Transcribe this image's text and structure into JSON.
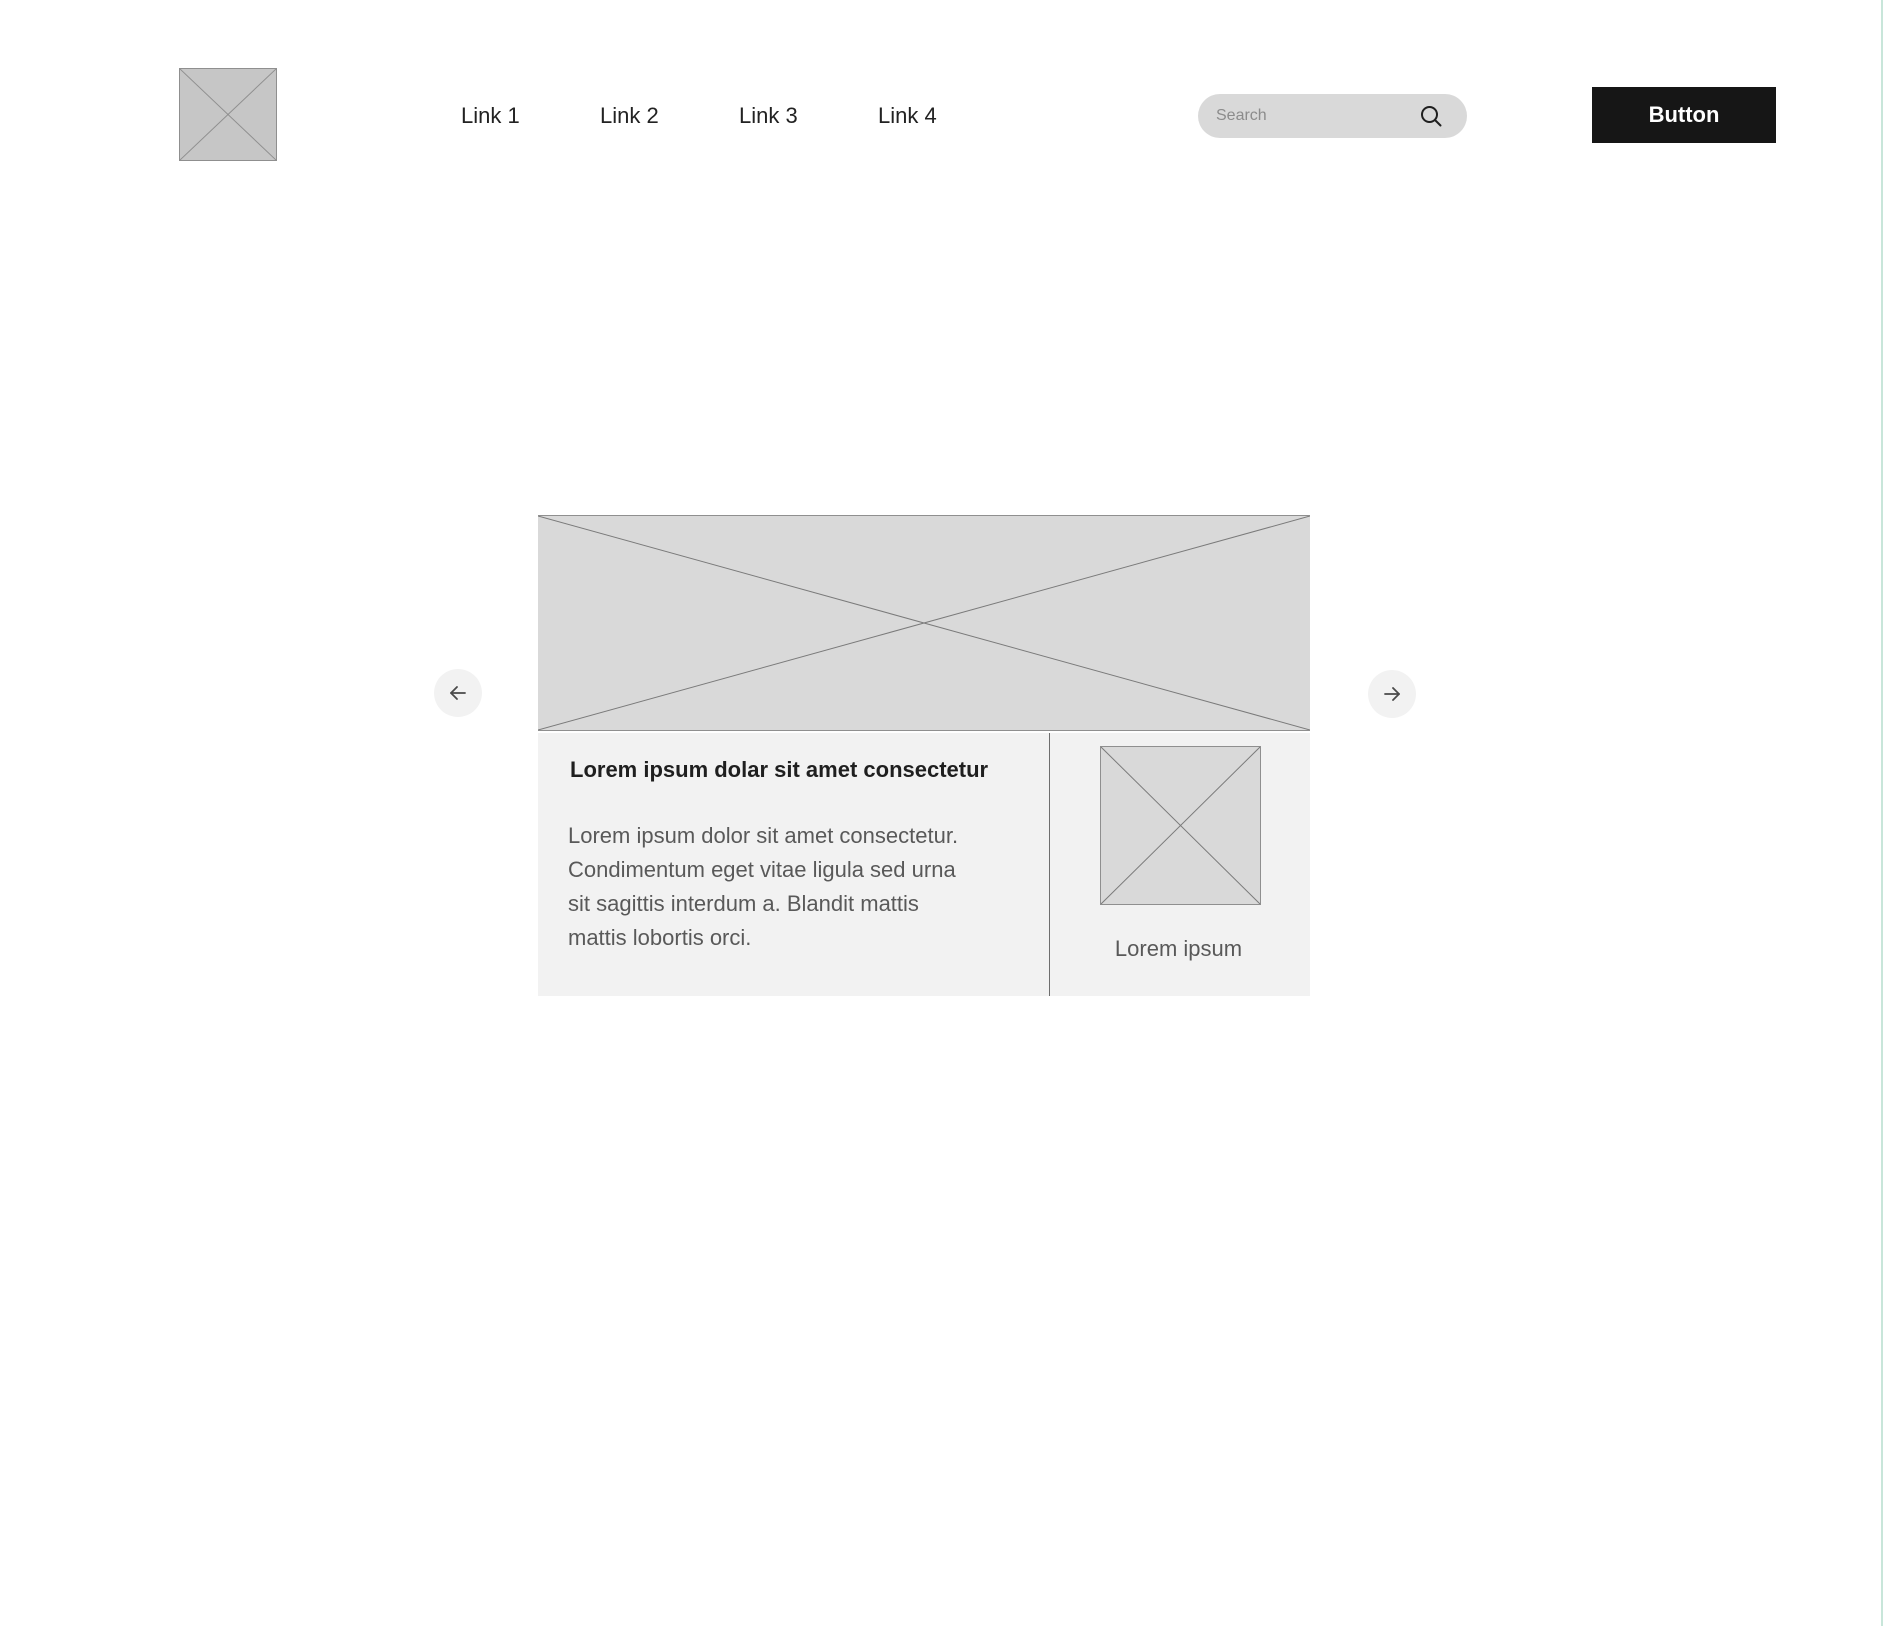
{
  "header": {
    "logo_icon": "image-placeholder-icon",
    "nav_links": [
      "Link 1",
      "Link 2",
      "Link 3",
      "Link 4"
    ],
    "search": {
      "placeholder": "Search",
      "value": "",
      "icon": "search-icon"
    },
    "button_label": "Button"
  },
  "carousel": {
    "prev_icon": "arrow-left-icon",
    "next_icon": "arrow-right-icon",
    "card": {
      "title": "Lorem ipsum dolar sit amet consectetur",
      "body": "Lorem ipsum dolor sit amet consectetur. Condimentum eget vitae ligula sed urna sit sagittis interdum a. Blandit mattis mattis lobortis orci.",
      "thumb_caption": "Lorem ipsum"
    }
  },
  "colors": {
    "placeholder_fill": "#d9d9d9",
    "card_background": "#f2f2f2",
    "button_background": "#161616",
    "button_text": "#ffffff"
  }
}
